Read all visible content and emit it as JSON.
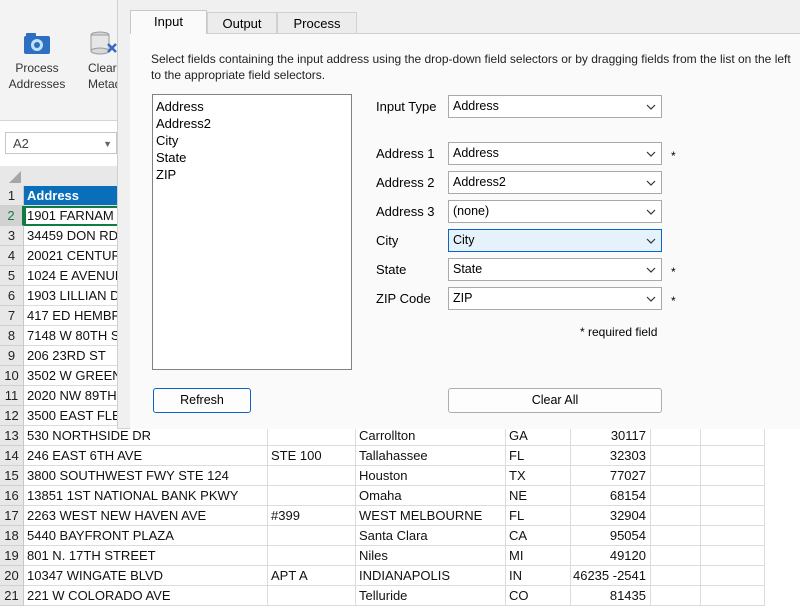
{
  "ribbon": {
    "process_label_1": "Process",
    "process_label_2": "Addresses",
    "clear_label_1": "Clear",
    "clear_label_2": "Metada"
  },
  "name_box": {
    "value": "A2"
  },
  "spreadsheet": {
    "rows": [
      {
        "n": "1",
        "a": "Address",
        "b": "",
        "c": "",
        "d": "",
        "e": ""
      },
      {
        "n": "2",
        "a": "1901 FARNAM",
        "b": "",
        "c": "",
        "d": "",
        "e": ""
      },
      {
        "n": "3",
        "a": "34459 DON RD",
        "b": "",
        "c": "",
        "d": "",
        "e": ""
      },
      {
        "n": "4",
        "a": "20021 CENTUR",
        "b": "",
        "c": "",
        "d": "",
        "e": ""
      },
      {
        "n": "5",
        "a": "1024 E AVENUE",
        "b": "",
        "c": "",
        "d": "",
        "e": ""
      },
      {
        "n": "6",
        "a": "1903 LILLIAN D",
        "b": "",
        "c": "",
        "d": "",
        "e": ""
      },
      {
        "n": "7",
        "a": "417 ED HEMBR",
        "b": "",
        "c": "",
        "d": "",
        "e": ""
      },
      {
        "n": "8",
        "a": "7148 W 80TH S",
        "b": "",
        "c": "",
        "d": "",
        "e": ""
      },
      {
        "n": "9",
        "a": "206 23RD ST",
        "b": "",
        "c": "",
        "d": "",
        "e": ""
      },
      {
        "n": "10",
        "a": "3502 W GREEN",
        "b": "",
        "c": "",
        "d": "",
        "e": ""
      },
      {
        "n": "11",
        "a": "2020 NW 89TH",
        "b": "",
        "c": "",
        "d": "",
        "e": ""
      },
      {
        "n": "12",
        "a": "3500 EAST FLET",
        "b": "",
        "c": "",
        "d": "",
        "e": ""
      },
      {
        "n": "13",
        "a": "530 NORTHSIDE DR",
        "b": "",
        "c": "Carrollton",
        "d": "GA",
        "e": "30117"
      },
      {
        "n": "14",
        "a": "246 EAST 6TH AVE",
        "b": "STE 100",
        "c": "Tallahassee",
        "d": "FL",
        "e": "32303"
      },
      {
        "n": "15",
        "a": "3800 SOUTHWEST FWY STE 124",
        "b": "",
        "c": "Houston",
        "d": "TX",
        "e": "77027"
      },
      {
        "n": "16",
        "a": "13851 1ST NATIONAL BANK PKWY",
        "b": "",
        "c": "Omaha",
        "d": "NE",
        "e": "68154"
      },
      {
        "n": "17",
        "a": "2263 WEST NEW HAVEN AVE",
        "b": "#399",
        "c": "WEST MELBOURNE",
        "d": "FL",
        "e": "32904"
      },
      {
        "n": "18",
        "a": "5440 BAYFRONT PLAZA",
        "b": "",
        "c": "Santa Clara",
        "d": "CA",
        "e": "95054"
      },
      {
        "n": "19",
        "a": "801 N. 17TH STREET",
        "b": "",
        "c": "Niles",
        "d": "MI",
        "e": "49120"
      },
      {
        "n": "20",
        "a": "10347 WINGATE BLVD",
        "b": "APT A",
        "c": "INDIANAPOLIS",
        "d": "IN",
        "e": "46235 -2541"
      },
      {
        "n": "21",
        "a": "221 W COLORADO AVE",
        "b": "",
        "c": "Telluride",
        "d": "CO",
        "e": "81435"
      }
    ]
  },
  "dialog": {
    "tabs": [
      "Input",
      "Output",
      "Process"
    ],
    "active_tab": "Input",
    "instructions": "Select fields containing the input address using the drop-down field selectors or by dragging fields from the list on the left to the appropriate field selectors.",
    "field_list": [
      "Address",
      "Address2",
      "City",
      "State",
      "ZIP"
    ],
    "input_type": {
      "label": "Input Type",
      "value": "Address"
    },
    "fields": [
      {
        "label": "Address 1",
        "value": "Address",
        "required": "*"
      },
      {
        "label": "Address 2",
        "value": "Address2",
        "required": ""
      },
      {
        "label": "Address 3",
        "value": "(none)",
        "required": ""
      },
      {
        "label": "City",
        "value": "City",
        "required": ""
      },
      {
        "label": "State",
        "value": "State",
        "required": "*"
      },
      {
        "label": "ZIP Code",
        "value": "ZIP",
        "required": "*"
      }
    ],
    "required_note": "* required field",
    "refresh_label": "Refresh",
    "clear_all_label": "Clear All"
  },
  "colors": {
    "header_fill": "#0a6fba",
    "selection": "#107c41",
    "focus": "#0a64c8"
  },
  "icons": {
    "process": "gear-globe-icon",
    "clear": "database-clear-icon",
    "dropdown": "chevron-down-icon"
  }
}
